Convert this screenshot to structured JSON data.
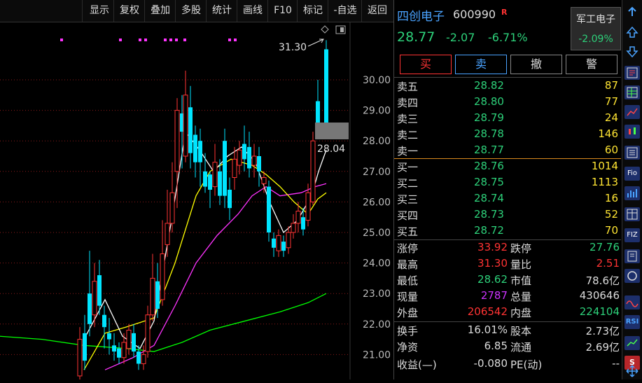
{
  "toolbar": {
    "items": [
      "显示",
      "复权",
      "叠加",
      "多股",
      "统计",
      "画线",
      "F10",
      "标记",
      "-自选",
      "返回"
    ]
  },
  "chart": {
    "price_ticks": [
      "30.00",
      "29.00",
      "28.00",
      "27.00",
      "26.00",
      "25.00",
      "24.00",
      "23.00",
      "22.00",
      "21.00"
    ],
    "high_label": "31.30",
    "current_label": "28.04",
    "colors": {
      "up": "#ff3333",
      "down": "#00e5ff",
      "ma5": "#ffffff",
      "ma10": "#ffff00",
      "ma20": "#ff33ff",
      "ma60": "#00ff00",
      "grid": "#8b1a1a"
    }
  },
  "quote": {
    "name": "四创电子",
    "code": "600990",
    "r_tag": "R",
    "price": "28.77",
    "change": "-2.07",
    "change_pct": "-6.71%",
    "sector_name": "军工电子",
    "sector_pct": "-2.09%"
  },
  "actions": {
    "buy": "买",
    "sell": "卖",
    "cancel": "撤",
    "alert": "警"
  },
  "order_book": {
    "asks": [
      {
        "label": "卖五",
        "price": "28.82",
        "vol": "87"
      },
      {
        "label": "卖四",
        "price": "28.80",
        "vol": "77"
      },
      {
        "label": "卖三",
        "price": "28.79",
        "vol": "24"
      },
      {
        "label": "卖二",
        "price": "28.78",
        "vol": "146"
      },
      {
        "label": "卖一",
        "price": "28.77",
        "vol": "60"
      }
    ],
    "bids": [
      {
        "label": "买一",
        "price": "28.76",
        "vol": "1014"
      },
      {
        "label": "买二",
        "price": "28.75",
        "vol": "1113"
      },
      {
        "label": "买三",
        "price": "28.74",
        "vol": "16"
      },
      {
        "label": "买四",
        "price": "28.73",
        "vol": "52"
      },
      {
        "label": "买五",
        "price": "28.72",
        "vol": "70"
      }
    ]
  },
  "stats": {
    "zt_l": "涨停",
    "zt_v": "33.92",
    "dt_l": "跌停",
    "dt_v": "27.76",
    "gao_l": "最高",
    "gao_v": "31.30",
    "lb_l": "量比",
    "lb_v": "2.51",
    "di_l": "最低",
    "di_v": "28.62",
    "sz_l": "市值",
    "sz_v": "78.6亿",
    "xl_l": "现量",
    "xl_v": "2787",
    "zl_l": "总量",
    "zl_v": "430646",
    "wp_l": "外盘",
    "wp_v": "206542",
    "np_l": "内盘",
    "np_v": "224104",
    "hs_l": "换手",
    "hs_v": "16.01%",
    "gb_l": "股本",
    "gb_v": "2.73亿",
    "jz_l": "净资",
    "jz_v": "6.85",
    "lt_l": "流通",
    "lt_v": "2.69亿",
    "sy_l": "收益(—)",
    "sy_v": "-0.080",
    "pe_l": "PE(动)",
    "pe_v": "--"
  },
  "sidebar": {
    "fio": "Fio",
    "fiz": "FIZ",
    "rsi": "RSI",
    "s": "S"
  }
}
